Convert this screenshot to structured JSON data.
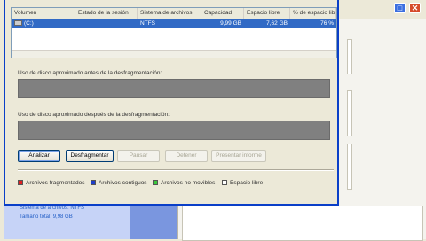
{
  "list": {
    "headers": [
      "Volumen",
      "Estado de la sesión",
      "Sistema de archivos",
      "Capacidad",
      "Espacio libre",
      "% de espacio libre"
    ],
    "rows": [
      {
        "volume": "(C:)",
        "status": "",
        "fs": "NTFS",
        "capacity": "9,99 GB",
        "free": "7,62 GB",
        "pct": "76 %"
      }
    ]
  },
  "before_label": "Uso de disco aproximado antes de la desfragmentación:",
  "after_label": "Uso de disco aproximado después de la desfragmentación:",
  "buttons": {
    "analyze": "Analizar",
    "defrag": "Desfragmentar",
    "pause": "Pausar",
    "stop": "Detener",
    "report": "Presentar informe"
  },
  "legend": {
    "fragmented": "Archivos fragmentados",
    "contiguous": "Archivos contiguos",
    "unmovable": "Archivos no movibles",
    "free": "Espacio libre"
  },
  "legend_colors": {
    "fragmented": "#e02020",
    "contiguous": "#1f3fc8",
    "unmovable": "#39c93b",
    "free": "#ffffff"
  },
  "left_pane": {
    "fs_line": "Sistema de archivos: NTFS",
    "size_line": "Tamaño total: 9,98 GB"
  },
  "window_controls": {
    "maximize": "□",
    "close": "✕"
  }
}
